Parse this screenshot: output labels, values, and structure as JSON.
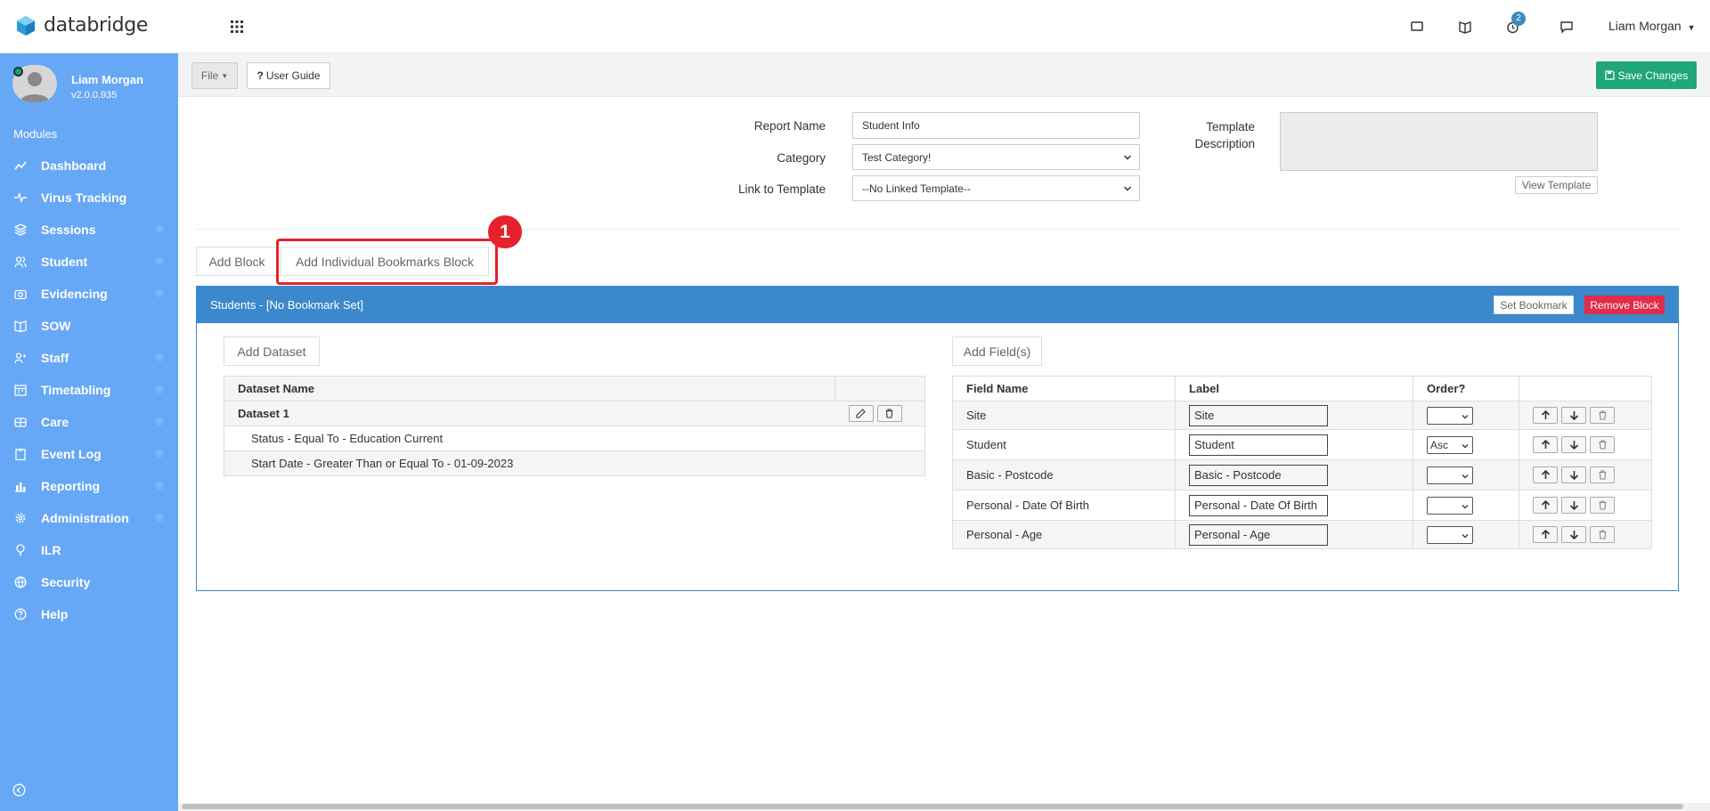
{
  "app": {
    "name": "databridge"
  },
  "header": {
    "user_name": "Liam Morgan",
    "notification_count": "2"
  },
  "sidebar": {
    "user_name": "Liam Morgan",
    "version": "v2.0.0.935",
    "section_label": "Modules",
    "items": [
      {
        "label": "Dashboard",
        "icon": "chart-line-icon",
        "has_children": false
      },
      {
        "label": "Virus Tracking",
        "icon": "pulse-icon",
        "has_children": false
      },
      {
        "label": "Sessions",
        "icon": "layers-icon",
        "has_children": true
      },
      {
        "label": "Student",
        "icon": "users-icon",
        "has_children": true
      },
      {
        "label": "Evidencing",
        "icon": "camera-icon",
        "has_children": true
      },
      {
        "label": "SOW",
        "icon": "book-icon",
        "has_children": false
      },
      {
        "label": "Staff",
        "icon": "staff-icon",
        "has_children": true
      },
      {
        "label": "Timetabling",
        "icon": "calendar-icon",
        "has_children": true
      },
      {
        "label": "Care",
        "icon": "care-icon",
        "has_children": true
      },
      {
        "label": "Event Log",
        "icon": "clipboard-icon",
        "has_children": true
      },
      {
        "label": "Reporting",
        "icon": "bar-chart-icon",
        "has_children": true
      },
      {
        "label": "Administration",
        "icon": "gear-icon",
        "has_children": true
      },
      {
        "label": "ILR",
        "icon": "tree-icon",
        "has_children": false
      },
      {
        "label": "Security",
        "icon": "globe-icon",
        "has_children": false
      },
      {
        "label": "Help",
        "icon": "help-icon",
        "has_children": false
      }
    ]
  },
  "toolbar": {
    "file_label": "File",
    "guide_label": "User Guide",
    "save_label": "Save Changes"
  },
  "form": {
    "report_name_label": "Report Name",
    "report_name_value": "Student Info",
    "category_label": "Category",
    "category_value": "Test Category!",
    "link_template_label": "Link to Template",
    "link_template_value": "--No Linked Template--",
    "template_desc_label_1": "Template",
    "template_desc_label_2": "Description",
    "view_template_label": "View Template"
  },
  "block_buttons": {
    "add_block": "Add Block",
    "add_individual": "Add Individual Bookmarks Block"
  },
  "annotation": {
    "number": "1"
  },
  "panel": {
    "title": "Students - [No Bookmark Set]",
    "set_bookmark_label": "Set Bookmark",
    "remove_block_label": "Remove Block",
    "add_dataset_label": "Add Dataset",
    "add_fields_label": "Add Field(s)",
    "dataset_header": "Dataset Name",
    "dataset_name": "Dataset 1",
    "filters": [
      "Status - Equal To - Education Current",
      "Start Date - Greater Than or Equal To - 01-09-2023"
    ],
    "fields_headers": {
      "name": "Field Name",
      "label": "Label",
      "order": "Order?"
    },
    "fields": [
      {
        "name": "Site",
        "label": "Site",
        "order": ""
      },
      {
        "name": "Student",
        "label": "Student",
        "order": "Asc"
      },
      {
        "name": "Basic - Postcode",
        "label": "Basic - Postcode",
        "order": ""
      },
      {
        "name": "Personal - Date Of Birth",
        "label": "Personal - Date Of Birth",
        "order": ""
      },
      {
        "name": "Personal - Age",
        "label": "Personal - Age",
        "order": ""
      }
    ]
  },
  "colors": {
    "sidebar": "#66a8f5",
    "panel_header": "#3b88cc",
    "save": "#1fa67a",
    "remove": "#e02d4a",
    "highlight": "#e5212b"
  }
}
